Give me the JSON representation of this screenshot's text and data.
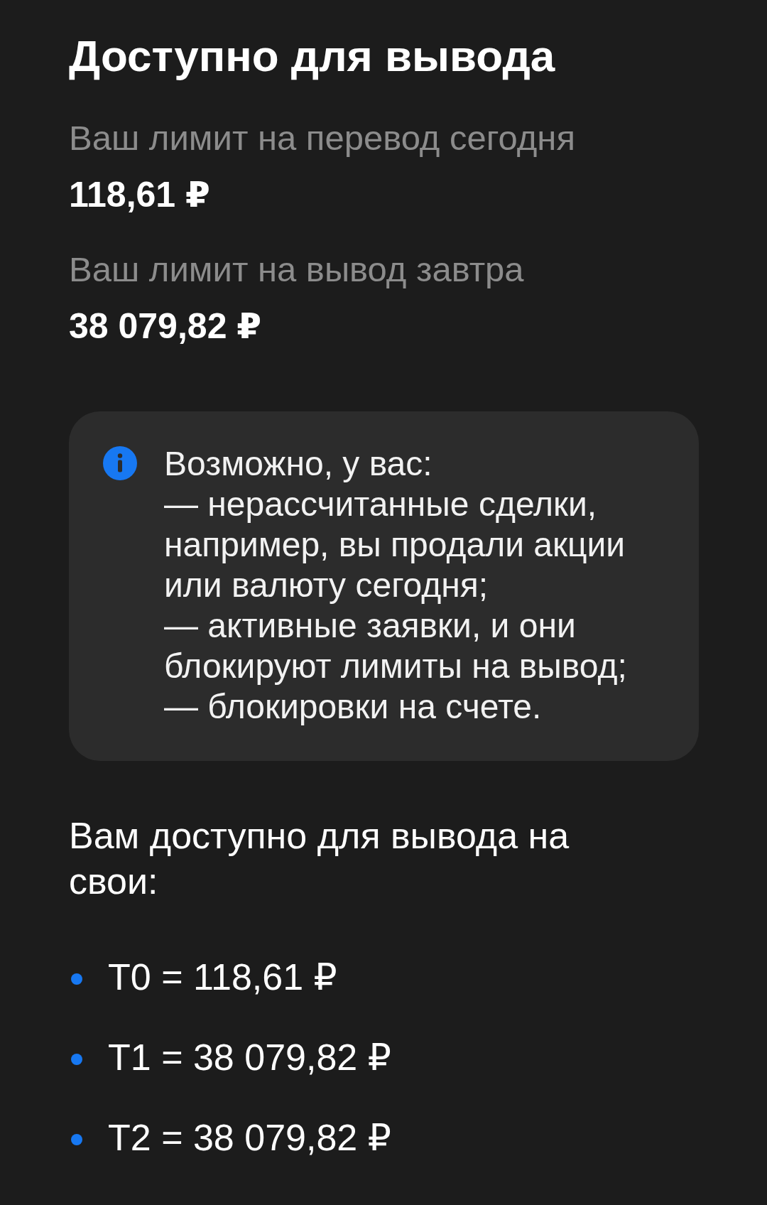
{
  "title": "Доступно для вывода",
  "limits": [
    {
      "label": "Ваш лимит на перевод сегодня",
      "value": "118,61 ₽"
    },
    {
      "label": "Ваш лимит на вывод завтра",
      "value": "38 079,82 ₽"
    }
  ],
  "notice": {
    "text": "Возможно, у вас:\n— нерассчитанные сделки, например, вы продали акции или валюту сегодня;\n— активные заявки, и они блокируют лимиты на вывод;\n— блокировки на счете."
  },
  "available": {
    "heading": "Вам доступно для вывода на свои:",
    "items": [
      "T0 = 118,61 ₽",
      "T1 = 38 079,82 ₽",
      "T2 = 38 079,82 ₽"
    ]
  }
}
